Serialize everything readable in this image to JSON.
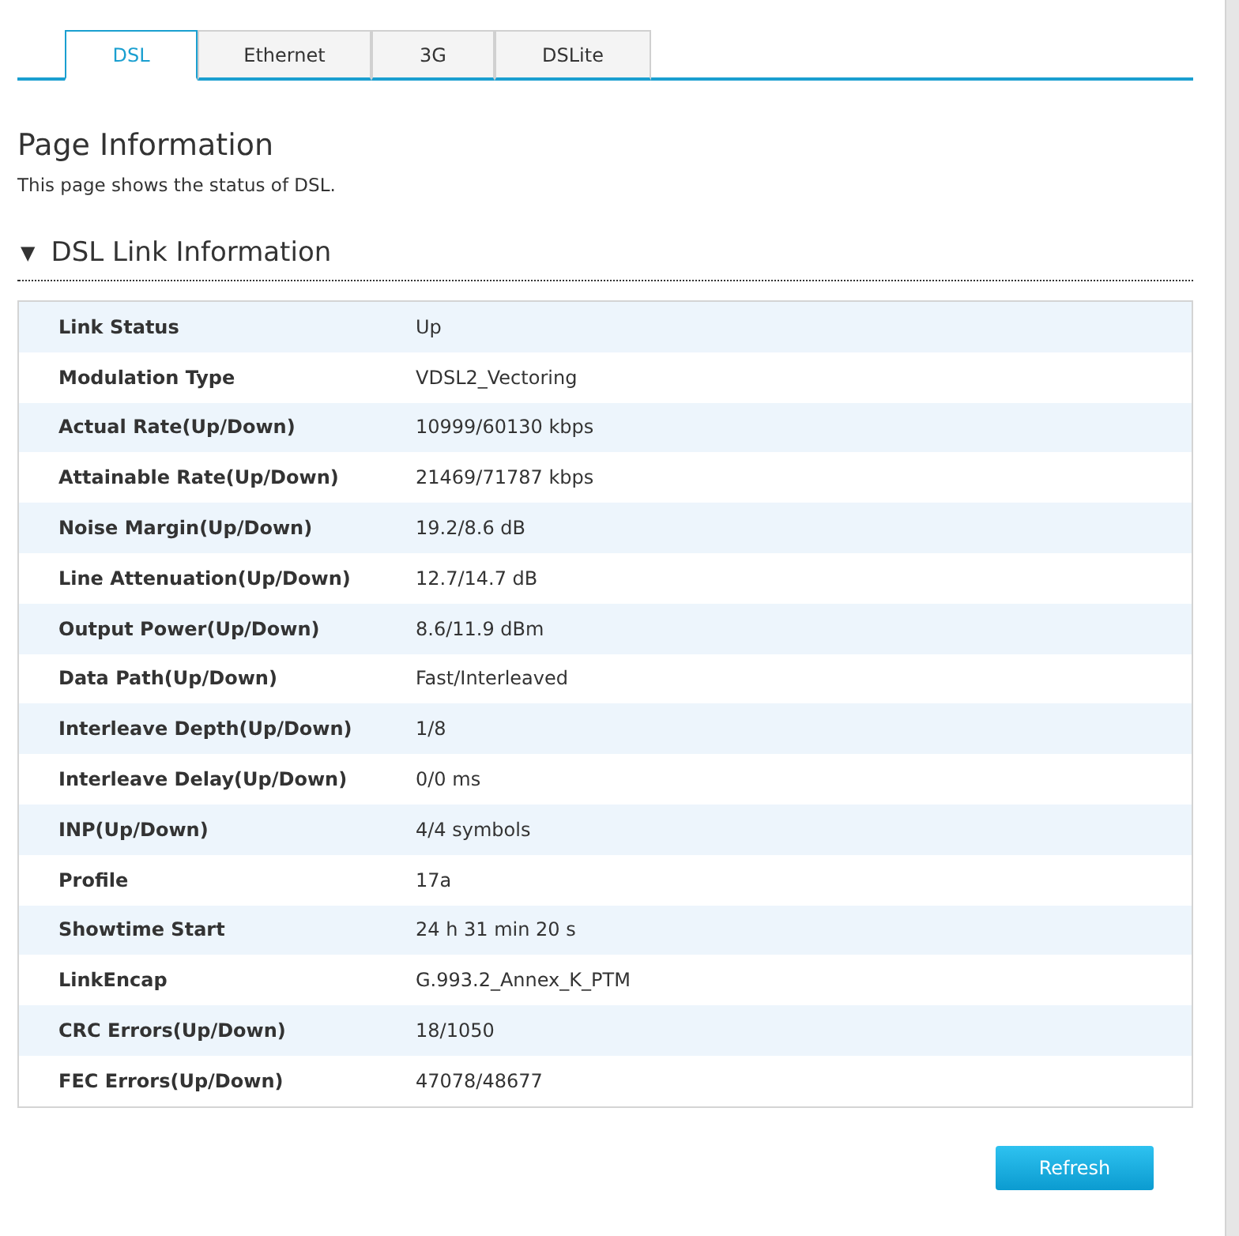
{
  "tabs": [
    {
      "label": "DSL",
      "selected": true
    },
    {
      "label": "Ethernet",
      "selected": false
    },
    {
      "label": "3G",
      "selected": false
    },
    {
      "label": "DSLite",
      "selected": false
    }
  ],
  "page": {
    "title": "Page Information",
    "description": "This page shows the status of DSL."
  },
  "section": {
    "title": "DSL Link Information",
    "expanded": true,
    "toggle": "▼"
  },
  "rows": [
    {
      "label": "Link Status",
      "value": "Up"
    },
    {
      "label": "Modulation Type",
      "value": "VDSL2_Vectoring"
    },
    {
      "label": "Actual Rate(Up/Down)",
      "value": "10999/60130 kbps"
    },
    {
      "label": "Attainable Rate(Up/Down)",
      "value": "21469/71787 kbps"
    },
    {
      "label": "Noise Margin(Up/Down)",
      "value": "19.2/8.6 dB"
    },
    {
      "label": "Line Attenuation(Up/Down)",
      "value": "12.7/14.7 dB"
    },
    {
      "label": "Output Power(Up/Down)",
      "value": "8.6/11.9 dBm"
    },
    {
      "label": "Data Path(Up/Down)",
      "value": "Fast/Interleaved"
    },
    {
      "label": "Interleave Depth(Up/Down)",
      "value": "1/8"
    },
    {
      "label": "Interleave Delay(Up/Down)",
      "value": "0/0 ms"
    },
    {
      "label": "INP(Up/Down)",
      "value": "4/4 symbols"
    },
    {
      "label": "Profile",
      "value": "17a"
    },
    {
      "label": "Showtime Start",
      "value": "24 h 31 min 20 s"
    },
    {
      "label": "LinkEncap",
      "value": "G.993.2_Annex_K_PTM"
    },
    {
      "label": "CRC Errors(Up/Down)",
      "value": "18/1050"
    },
    {
      "label": "FEC Errors(Up/Down)",
      "value": "47078/48677"
    }
  ],
  "buttons": [
    {
      "label": "Refresh"
    }
  ]
}
